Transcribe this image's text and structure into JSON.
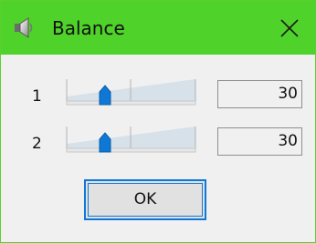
{
  "window": {
    "title": "Balance",
    "title_icon": "speaker-icon",
    "close_icon": "close-icon",
    "titlebar_color": "#4fd22a",
    "accent_color": "#0f78d6"
  },
  "rows": [
    {
      "label": "1",
      "slider_level_percent": 30,
      "value": "30"
    },
    {
      "label": "2",
      "slider_level_percent": 30,
      "value": "30"
    }
  ],
  "ok_button": {
    "label": "OK"
  }
}
